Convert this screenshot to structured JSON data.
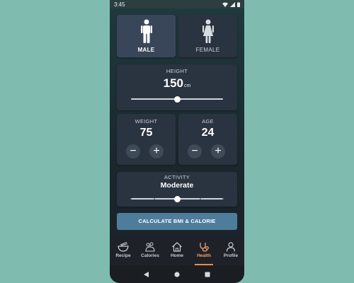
{
  "status": {
    "time": "3:45"
  },
  "gender": {
    "male_label": "MALE",
    "female_label": "FEMALE",
    "selected": "male"
  },
  "height": {
    "label": "HEIGHT",
    "value": "150",
    "unit": "cm",
    "slider_fraction": 0.5
  },
  "weight": {
    "label": "WEIGHT",
    "value": "75",
    "minus": "−",
    "plus": "+"
  },
  "age": {
    "label": "AGE",
    "value": "24",
    "minus": "−",
    "plus": "+"
  },
  "activity": {
    "label": "ACTIVITY",
    "value": "Moderate",
    "slider_fraction": 0.5,
    "steps": 5
  },
  "calculate_button": "CALCULATE BMI & CALORIE",
  "nav": {
    "items": [
      {
        "label": "Recipe",
        "icon": "bowl-icon"
      },
      {
        "label": "Calories",
        "icon": "food-icon"
      },
      {
        "label": "Home",
        "icon": "home-icon"
      },
      {
        "label": "Health",
        "icon": "stethoscope-icon",
        "active": true
      },
      {
        "label": "Profile",
        "icon": "person-icon"
      }
    ]
  },
  "colors": {
    "background": "#7fbcaf",
    "card": "#2a3340",
    "card_active": "#39465a",
    "accent_button": "#4e7d9c",
    "nav_active": "#e98b4f"
  }
}
